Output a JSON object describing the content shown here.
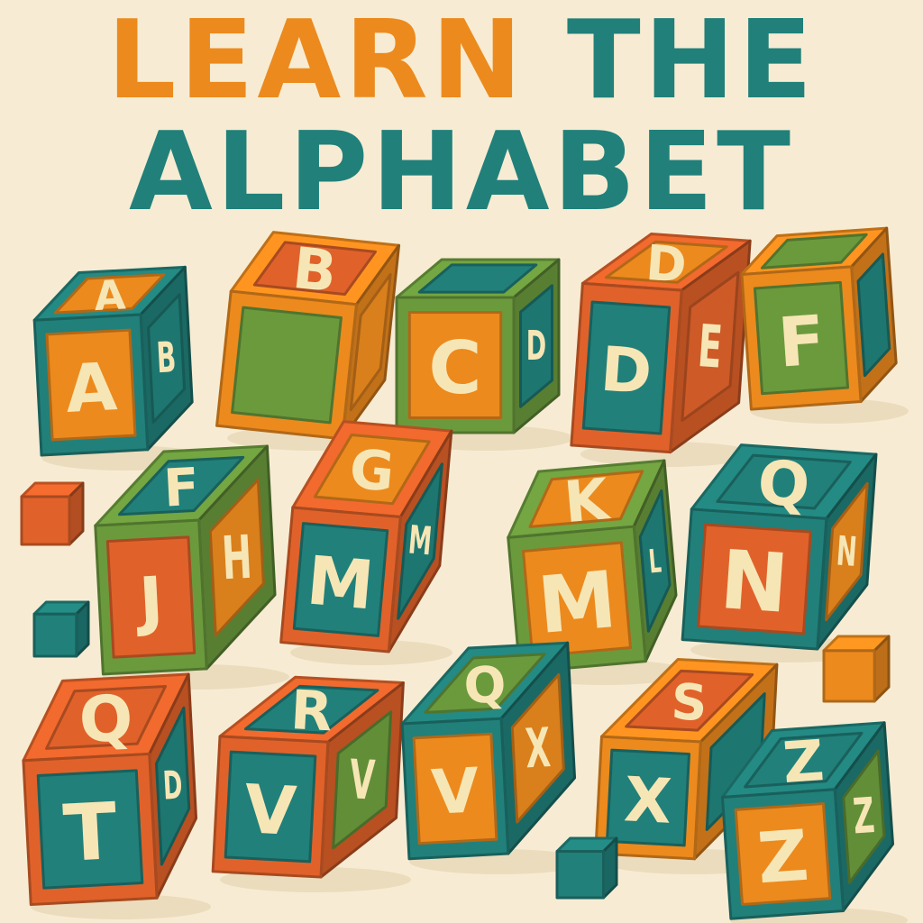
{
  "title": {
    "line1": [
      "LEARN",
      "THE"
    ],
    "line2": "ALPHABET"
  },
  "colors": {
    "background": "#f7ecd3",
    "title_orange": "#ec8a1e",
    "title_teal": "#21807a",
    "orange": "#ec8a1e",
    "red_orange": "#e0622a",
    "teal": "#21807a",
    "green": "#6b9a3d",
    "letter": "#f7e6b5"
  },
  "blocks": [
    {
      "name": "block-a",
      "top": "A",
      "front": "A",
      "side": "B",
      "frame": "teal",
      "top_fill": "orange",
      "front_fill": "orange",
      "side_fill": "teal"
    },
    {
      "name": "block-b",
      "top": "B",
      "front": "",
      "side": "",
      "frame": "orange",
      "top_fill": "red_orange",
      "front_fill": "green",
      "side_fill": "orange"
    },
    {
      "name": "block-c",
      "top": "",
      "front": "C",
      "side": "D",
      "frame": "green",
      "top_fill": "teal",
      "front_fill": "orange",
      "side_fill": "teal"
    },
    {
      "name": "block-d",
      "top": "D",
      "front": "D",
      "side": "E",
      "frame": "red_orange",
      "top_fill": "orange",
      "front_fill": "teal",
      "side_fill": "red_orange"
    },
    {
      "name": "block-f-top",
      "top": "",
      "front": "F",
      "side": "",
      "frame": "orange",
      "top_fill": "green",
      "front_fill": "green",
      "side_fill": "teal"
    },
    {
      "name": "block-f",
      "top": "F",
      "front": "J",
      "side": "H",
      "frame": "green",
      "top_fill": "teal",
      "front_fill": "red_orange",
      "side_fill": "orange"
    },
    {
      "name": "block-g",
      "top": "G",
      "front": "M",
      "side": "M",
      "frame": "red_orange",
      "top_fill": "orange",
      "front_fill": "teal",
      "side_fill": "teal"
    },
    {
      "name": "block-k",
      "top": "K",
      "front": "M",
      "side": "L",
      "frame": "green",
      "top_fill": "orange",
      "front_fill": "orange",
      "side_fill": "teal"
    },
    {
      "name": "block-q",
      "top": "Q",
      "front": "N",
      "side": "N",
      "frame": "teal",
      "top_fill": "teal",
      "front_fill": "red_orange",
      "side_fill": "orange"
    },
    {
      "name": "block-q-2",
      "top": "Q",
      "front": "T",
      "side": "D",
      "frame": "red_orange",
      "top_fill": "red_orange",
      "front_fill": "teal",
      "side_fill": "teal"
    },
    {
      "name": "block-r",
      "top": "R",
      "front": "V",
      "side": "V",
      "frame": "red_orange",
      "top_fill": "teal",
      "front_fill": "teal",
      "side_fill": "green"
    },
    {
      "name": "block-q-3",
      "top": "Q",
      "front": "V",
      "side": "X",
      "frame": "teal",
      "top_fill": "green",
      "front_fill": "orange",
      "side_fill": "orange"
    },
    {
      "name": "block-s",
      "top": "S",
      "front": "X",
      "side": "",
      "frame": "orange",
      "top_fill": "red_orange",
      "front_fill": "teal",
      "side_fill": "teal"
    },
    {
      "name": "block-z",
      "top": "Z",
      "front": "Z",
      "side": "Z",
      "frame": "teal",
      "top_fill": "teal",
      "front_fill": "orange",
      "side_fill": "green"
    }
  ],
  "cubes": [
    {
      "name": "small-cube-orange-left",
      "color": "red_orange"
    },
    {
      "name": "small-cube-teal-left",
      "color": "teal"
    },
    {
      "name": "small-cube-orange-right",
      "color": "orange"
    },
    {
      "name": "small-cube-teal-bottom",
      "color": "teal"
    }
  ]
}
